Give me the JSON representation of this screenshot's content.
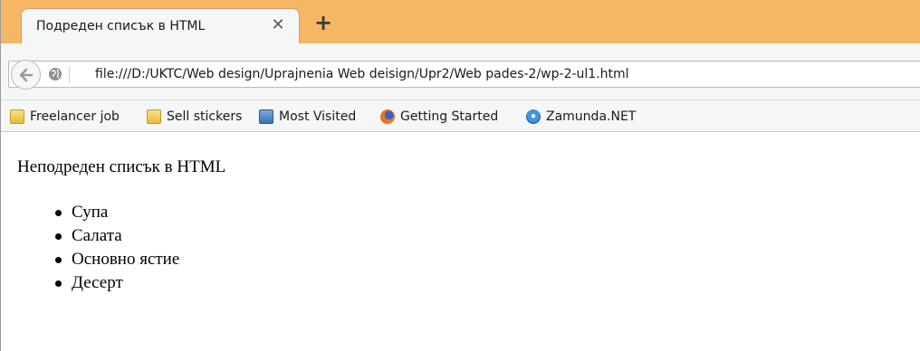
{
  "tab": {
    "title": "Подреден списък в HTML",
    "close_icon": "close-icon",
    "new_tab_icon": "plus-icon"
  },
  "navbar": {
    "back_icon": "back-arrow-icon",
    "site_icon": "globe-icon",
    "url": "file:///D:/UKTC/Web design/Uprajnenia Web deisign/Upr2/Web pades-2/wp-2-ul1.html"
  },
  "bookmarks": [
    {
      "label": "Freelancer job",
      "icon": "folder-icon"
    },
    {
      "label": "Sell stickers",
      "icon": "folder-icon"
    },
    {
      "label": "Most Visited",
      "icon": "most-visited-icon"
    },
    {
      "label": "Getting Started",
      "icon": "firefox-icon"
    },
    {
      "label": "Zamunda.NET",
      "icon": "zamunda-icon"
    }
  ],
  "page": {
    "heading": "Неподреден списък в HTML",
    "items": [
      "Супа",
      "Салата",
      "Основно ястие",
      "Десерт"
    ]
  },
  "colors": {
    "tabstrip": "#f6b765",
    "toolbar": "#f5f6f7"
  }
}
